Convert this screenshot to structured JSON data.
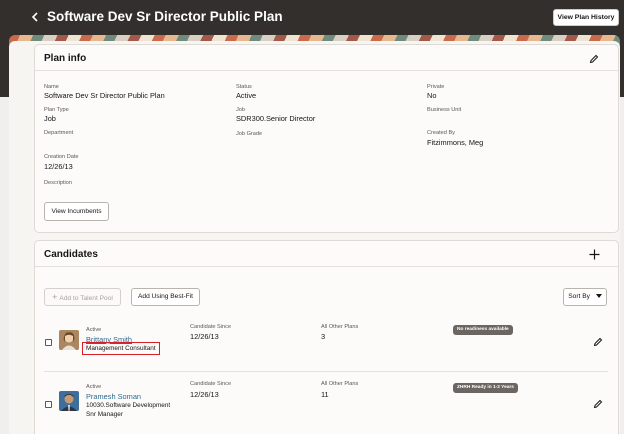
{
  "header": {
    "back_icon": "chevron-left-icon",
    "title": "Software Dev Sr Director Public Plan",
    "history_button": "View Plan History"
  },
  "plan_info": {
    "title": "Plan info",
    "edit_icon": "pencil-icon",
    "fields": {
      "name": {
        "label": "Name",
        "value": "Software Dev Sr Director Public Plan"
      },
      "status": {
        "label": "Status",
        "value": "Active"
      },
      "private": {
        "label": "Private",
        "value": "No"
      },
      "plan_type": {
        "label": "Plan Type",
        "value": "Job"
      },
      "job": {
        "label": "Job",
        "value": "SDR300.Senior Director"
      },
      "business_unit": {
        "label": "Business Unit",
        "value": ""
      },
      "department": {
        "label": "Department",
        "value": ""
      },
      "job_grade": {
        "label": "Job Grade",
        "value": ""
      },
      "created_by": {
        "label": "Created By",
        "value": "Fitzimmons, Meg"
      },
      "creation_date": {
        "label": "Creation Date",
        "value": "12/26/13"
      },
      "description": {
        "label": "Description",
        "value": ""
      }
    },
    "view_incumbents_button": "View Incumbents"
  },
  "candidates": {
    "title": "Candidates",
    "add_icon": "plus-icon",
    "add_to_pool_button": "Add to Talent Pool",
    "add_best_fit_button": "Add Using Best-Fit",
    "sort_button": "Sort By",
    "rows": [
      {
        "status": "Active",
        "name": "Brittany Smith",
        "job": "Management Consultant",
        "since_label": "Candidate Since",
        "since": "12/26/13",
        "other_label": "All Other Plans",
        "other": "3",
        "badge": "No readiness available"
      },
      {
        "status": "Active",
        "name": "Pramesh Soman",
        "job_line1": "10030.Software Development",
        "job_line2": "Snr Manager",
        "since_label": "Candidate Since",
        "since": "12/26/13",
        "other_label": "All Other Plans",
        "other": "11",
        "badge": "ZHRH Ready in 1-2 Years"
      }
    ]
  }
}
